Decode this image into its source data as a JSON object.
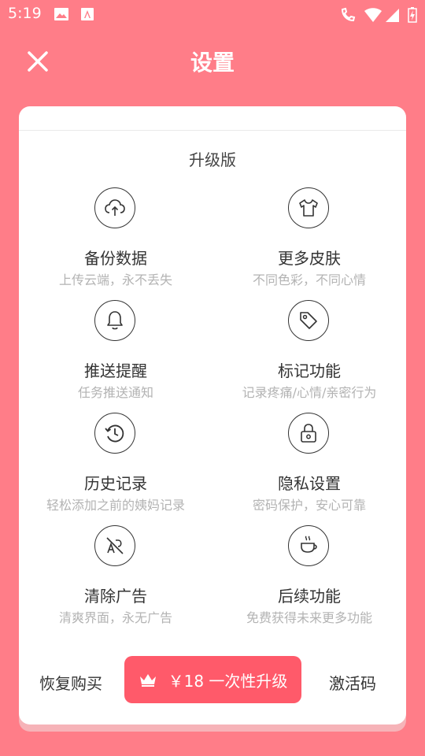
{
  "status_bar": {
    "time": "5:19"
  },
  "header": {
    "title": "设置"
  },
  "card": {
    "section_title": "升级版",
    "features": [
      {
        "title": "备份数据",
        "subtitle": "上传云端，永不丢失",
        "icon": "cloud-upload-icon"
      },
      {
        "title": "更多皮肤",
        "subtitle": "不同色彩，不同心情",
        "icon": "shirt-icon"
      },
      {
        "title": "推送提醒",
        "subtitle": "任务推送通知",
        "icon": "bell-icon"
      },
      {
        "title": "标记功能",
        "subtitle": "记录疼痛/心情/亲密行为",
        "icon": "tag-icon"
      },
      {
        "title": "历史记录",
        "subtitle": "轻松添加之前的姨妈记录",
        "icon": "history-icon"
      },
      {
        "title": "隐私设置",
        "subtitle": "密码保护，安心可靠",
        "icon": "lock-icon"
      },
      {
        "title": "清除广告",
        "subtitle": "清爽界面，永无广告",
        "icon": "no-ads-icon"
      },
      {
        "title": "后续功能",
        "subtitle": "免费获得未来更多功能",
        "icon": "coffee-icon"
      }
    ]
  },
  "actions": {
    "restore": "恢复购买",
    "upgrade": "￥18 一次性升级",
    "activate": "激活码"
  },
  "colors": {
    "background": "#ff7d88",
    "accent": "#ff5a6a",
    "card": "#ffffff",
    "subtitle": "#b3b3b3"
  }
}
